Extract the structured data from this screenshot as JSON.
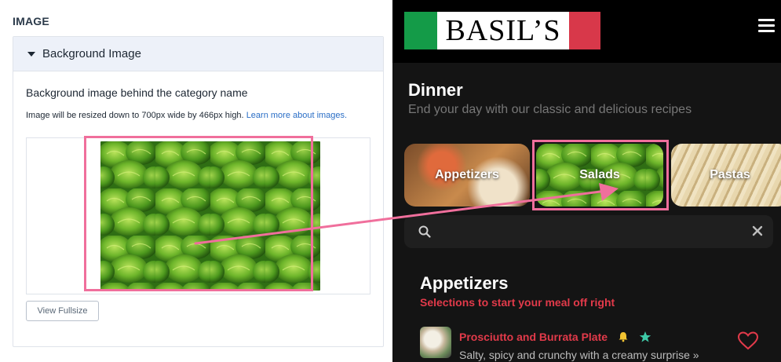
{
  "admin": {
    "section_title": "IMAGE",
    "panel_title": "Background Image",
    "field_label": "Background image behind the category name",
    "help_text": "Image will be resized down to 700px wide by 466px high.",
    "help_link": "Learn more about images.",
    "view_fullsize_label": "View Fullsize"
  },
  "app": {
    "logo_text": "BASIL’S",
    "menu_title": "Dinner",
    "menu_subtitle": "End your day with our classic and delicious recipes",
    "categories": [
      {
        "label": "Appetizers"
      },
      {
        "label": "Salads"
      },
      {
        "label": "Pastas"
      }
    ],
    "search": {
      "placeholder": "",
      "value": ""
    },
    "section": {
      "title": "Appetizers",
      "subtitle": "Selections to start your meal off right"
    },
    "items": [
      {
        "name": "Prosciutto and Burrata Plate",
        "description": "Salty, spicy and crunchy with a creamy surprise »"
      }
    ]
  },
  "colors": {
    "accent_red": "#e23a4a",
    "annotation_pink": "#f06f9c",
    "admin_link_blue": "#2a6ec6",
    "salad_green": "#3f8a1c"
  },
  "icons": [
    "caret-down-icon",
    "menu-icon",
    "search-icon",
    "clear-icon",
    "bell-icon",
    "star-icon",
    "heart-icon"
  ]
}
